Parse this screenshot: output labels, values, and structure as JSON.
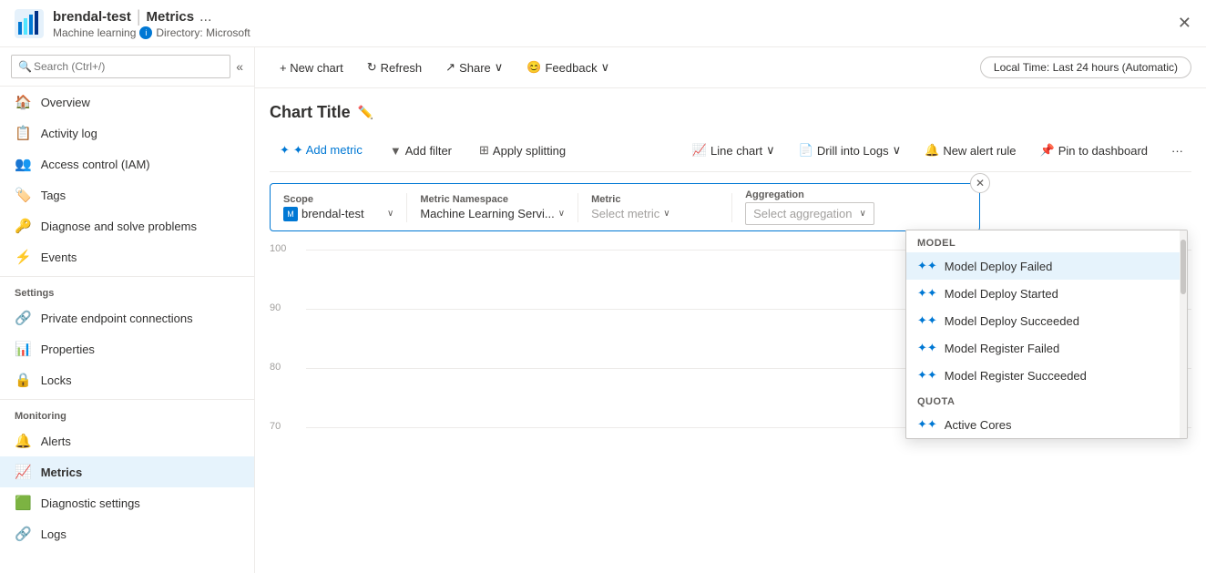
{
  "app": {
    "icon_text": "📊",
    "resource": "brendal-test",
    "separator": "|",
    "type": "Metrics",
    "subtitle": "Machine learning",
    "info_label": "i",
    "directory": "Directory: Microsoft",
    "ellipsis": "...",
    "close": "✕"
  },
  "search": {
    "placeholder": "Search (Ctrl+/)",
    "collapse_icon": "«"
  },
  "sidebar": {
    "items": [
      {
        "id": "overview",
        "label": "Overview",
        "icon": "🏠",
        "active": false
      },
      {
        "id": "activity-log",
        "label": "Activity log",
        "icon": "📋",
        "active": false
      },
      {
        "id": "access-control",
        "label": "Access control (IAM)",
        "icon": "👥",
        "active": false
      },
      {
        "id": "tags",
        "label": "Tags",
        "icon": "🏷️",
        "active": false
      },
      {
        "id": "diagnose",
        "label": "Diagnose and solve problems",
        "icon": "🔑",
        "active": false
      },
      {
        "id": "events",
        "label": "Events",
        "icon": "⚡",
        "active": false
      }
    ],
    "sections": [
      {
        "title": "Settings",
        "items": [
          {
            "id": "private-endpoint",
            "label": "Private endpoint connections",
            "icon": "🔗"
          },
          {
            "id": "properties",
            "label": "Properties",
            "icon": "📊"
          },
          {
            "id": "locks",
            "label": "Locks",
            "icon": "🔒"
          }
        ]
      },
      {
        "title": "Monitoring",
        "items": [
          {
            "id": "alerts",
            "label": "Alerts",
            "icon": "🔔"
          },
          {
            "id": "metrics",
            "label": "Metrics",
            "icon": "📈",
            "active": true
          },
          {
            "id": "diagnostic",
            "label": "Diagnostic settings",
            "icon": "🟩"
          },
          {
            "id": "logs",
            "label": "Logs",
            "icon": "🔗"
          }
        ]
      }
    ]
  },
  "toolbar": {
    "new_chart": "+ New chart",
    "refresh": "↻ Refresh",
    "share": "↗ Share",
    "share_arrow": "∨",
    "feedback": "😊 Feedback",
    "feedback_arrow": "∨",
    "time_range": "Local Time: Last 24 hours (Automatic)"
  },
  "chart": {
    "title": "Chart Title",
    "edit_icon": "✏️"
  },
  "metric_toolbar": {
    "add_metric": "✦ Add metric",
    "add_filter": "▼ Add filter",
    "apply_splitting": "⊞ Apply splitting",
    "line_chart": "📈 Line chart",
    "line_chart_arrow": "∨",
    "drill_logs": "📄 Drill into Logs",
    "drill_logs_arrow": "∨",
    "new_alert": "🔔 New alert rule",
    "pin_dashboard": "📌 Pin to dashboard",
    "more": "···"
  },
  "metric_selector": {
    "scope_label": "Scope",
    "scope_value": "brendal-test",
    "namespace_label": "Metric Namespace",
    "namespace_value": "Machine Learning Servi...",
    "metric_label": "Metric",
    "metric_placeholder": "Select metric",
    "aggregation_label": "Aggregation",
    "aggregation_placeholder": "Select aggregation"
  },
  "metric_dropdown": {
    "categories": [
      {
        "name": "MODEL",
        "items": [
          {
            "label": "Model Deploy Failed",
            "selected": true
          },
          {
            "label": "Model Deploy Started",
            "selected": false
          },
          {
            "label": "Model Deploy Succeeded",
            "selected": false
          },
          {
            "label": "Model Register Failed",
            "selected": false
          },
          {
            "label": "Model Register Succeeded",
            "selected": false
          }
        ]
      },
      {
        "name": "QUOTA",
        "items": [
          {
            "label": "Active Cores",
            "selected": false
          }
        ]
      }
    ]
  },
  "chart_grid": {
    "y_labels": [
      "100",
      "90",
      "80",
      "70"
    ]
  }
}
